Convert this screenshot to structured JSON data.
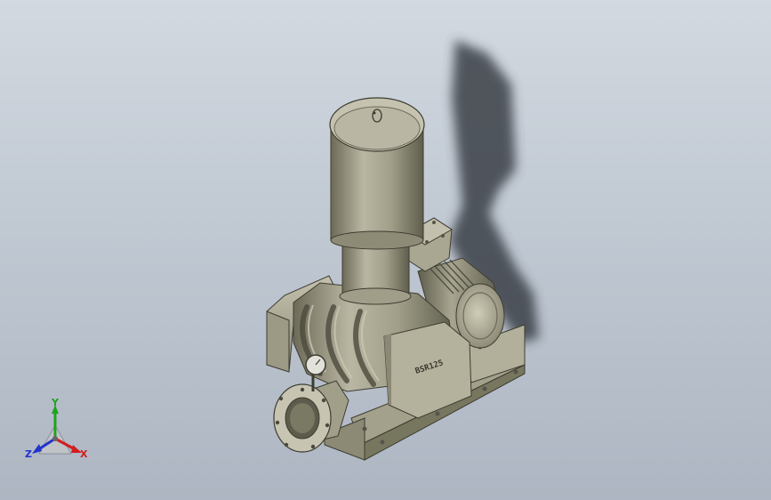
{
  "model": {
    "nameplate": "BSR125"
  },
  "triad": {
    "x_label": "X",
    "y_label": "Y",
    "z_label": "Z",
    "x_color": "#d11e1e",
    "y_color": "#1fa31f",
    "z_color": "#2233cc"
  },
  "colors": {
    "body_light": "#b5b39e",
    "body_mid": "#96947e",
    "body_dark": "#6b6a58",
    "shadow": "#3a3f47"
  },
  "icons": {
    "view_triad": "coordinate-triad-icon",
    "pressure_gauge": "gauge-icon"
  }
}
